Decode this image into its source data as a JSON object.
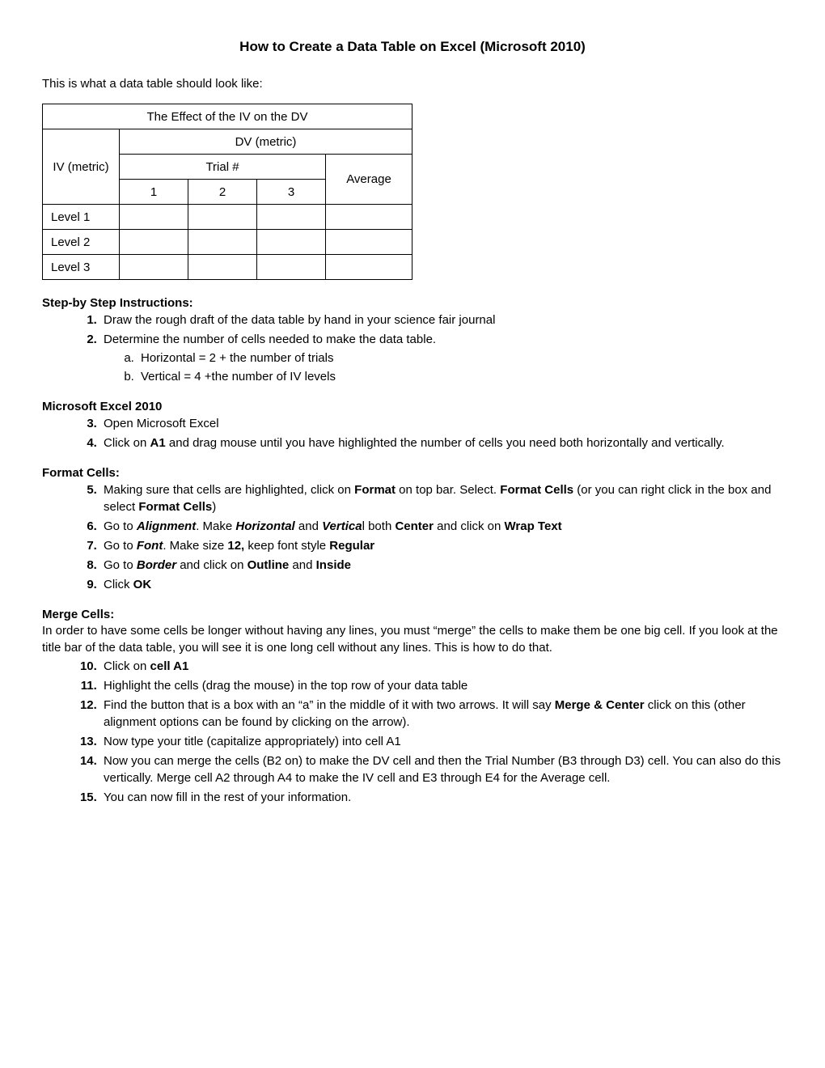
{
  "title": "How to Create a Data Table on Excel (Microsoft 2010)",
  "intro": "This is what a data table should look like:",
  "table": {
    "title": "The Effect of the IV on the DV",
    "iv": "IV (metric)",
    "dv": "DV (metric)",
    "trial": "Trial #",
    "t1": "1",
    "t2": "2",
    "t3": "3",
    "avg": "Average",
    "l1": "Level 1",
    "l2": "Level 2",
    "l3": "Level 3"
  },
  "sec1": {
    "head": "Step-by Step Instructions:",
    "i1": "Draw the rough draft of the data table by hand in your science fair journal",
    "i2": "Determine the number of cells needed to make the data table.",
    "i2a": "Horizontal = 2 + the number of trials",
    "i2b": "Vertical = 4 +the number of IV levels"
  },
  "sec2": {
    "head": "Microsoft Excel 2010",
    "i3": "Open Microsoft Excel",
    "i4a": "Click on ",
    "i4b": "A1",
    "i4c": " and drag mouse until you have highlighted the number of cells you need both horizontally and vertically."
  },
  "sec3": {
    "head": "Format Cells:",
    "i5a": " Making sure that cells are highlighted, click on ",
    "i5b": "Format",
    "i5c": " on top bar.  Select. ",
    "i5d": "Format Cells",
    "i5e": " (or you can right click in the box and select ",
    "i5f": "Format Cells",
    "i5g": ")",
    "i6a": "Go to ",
    "i6b": "Alignment",
    "i6c": ". Make ",
    "i6d": "Horizontal",
    "i6e": " and ",
    "i6f": "Vertica",
    "i6g": "l both ",
    "i6h": "Center",
    "i6i": " and click on ",
    "i6j": "Wrap Text",
    "i7a": "Go to ",
    "i7b": "Font",
    "i7c": ". Make size ",
    "i7d": "12,",
    "i7e": " keep font style ",
    "i7f": "Regular",
    "i8a": "Go to ",
    "i8b": "Border",
    "i8c": " and click on ",
    "i8d": "Outline",
    "i8e": " and ",
    "i8f": "Inside",
    "i9a": "Click ",
    "i9b": "OK"
  },
  "sec4": {
    "head": "Merge Cells:",
    "para": "In order to have some cells be longer without having any lines, you must “merge” the cells to make them be one big cell.  If you look at the title bar of the data table, you will see it is one long cell without any lines.  This is how to do that.",
    "i10a": "Click on ",
    "i10b": "cell A1",
    "i11": "Highlight the cells (drag the mouse) in the top row of your data table",
    "i12a": "Find the button that is a box with an “a” in the middle of it with two arrows. It will say ",
    "i12b": "Merge & Center",
    "i12c": " click on this (other alignment options can be found by clicking on the arrow).",
    "i13": "Now type your title (capitalize appropriately) into cell A1",
    "i14": "Now you can merge the cells (B2 on) to make the DV cell and then the Trial Number (B3 through D3) cell.  You can also do this vertically. Merge cell A2 through A4 to make the IV cell and E3 through E4 for the Average cell.",
    "i15": "You can now fill in the rest of your information."
  }
}
